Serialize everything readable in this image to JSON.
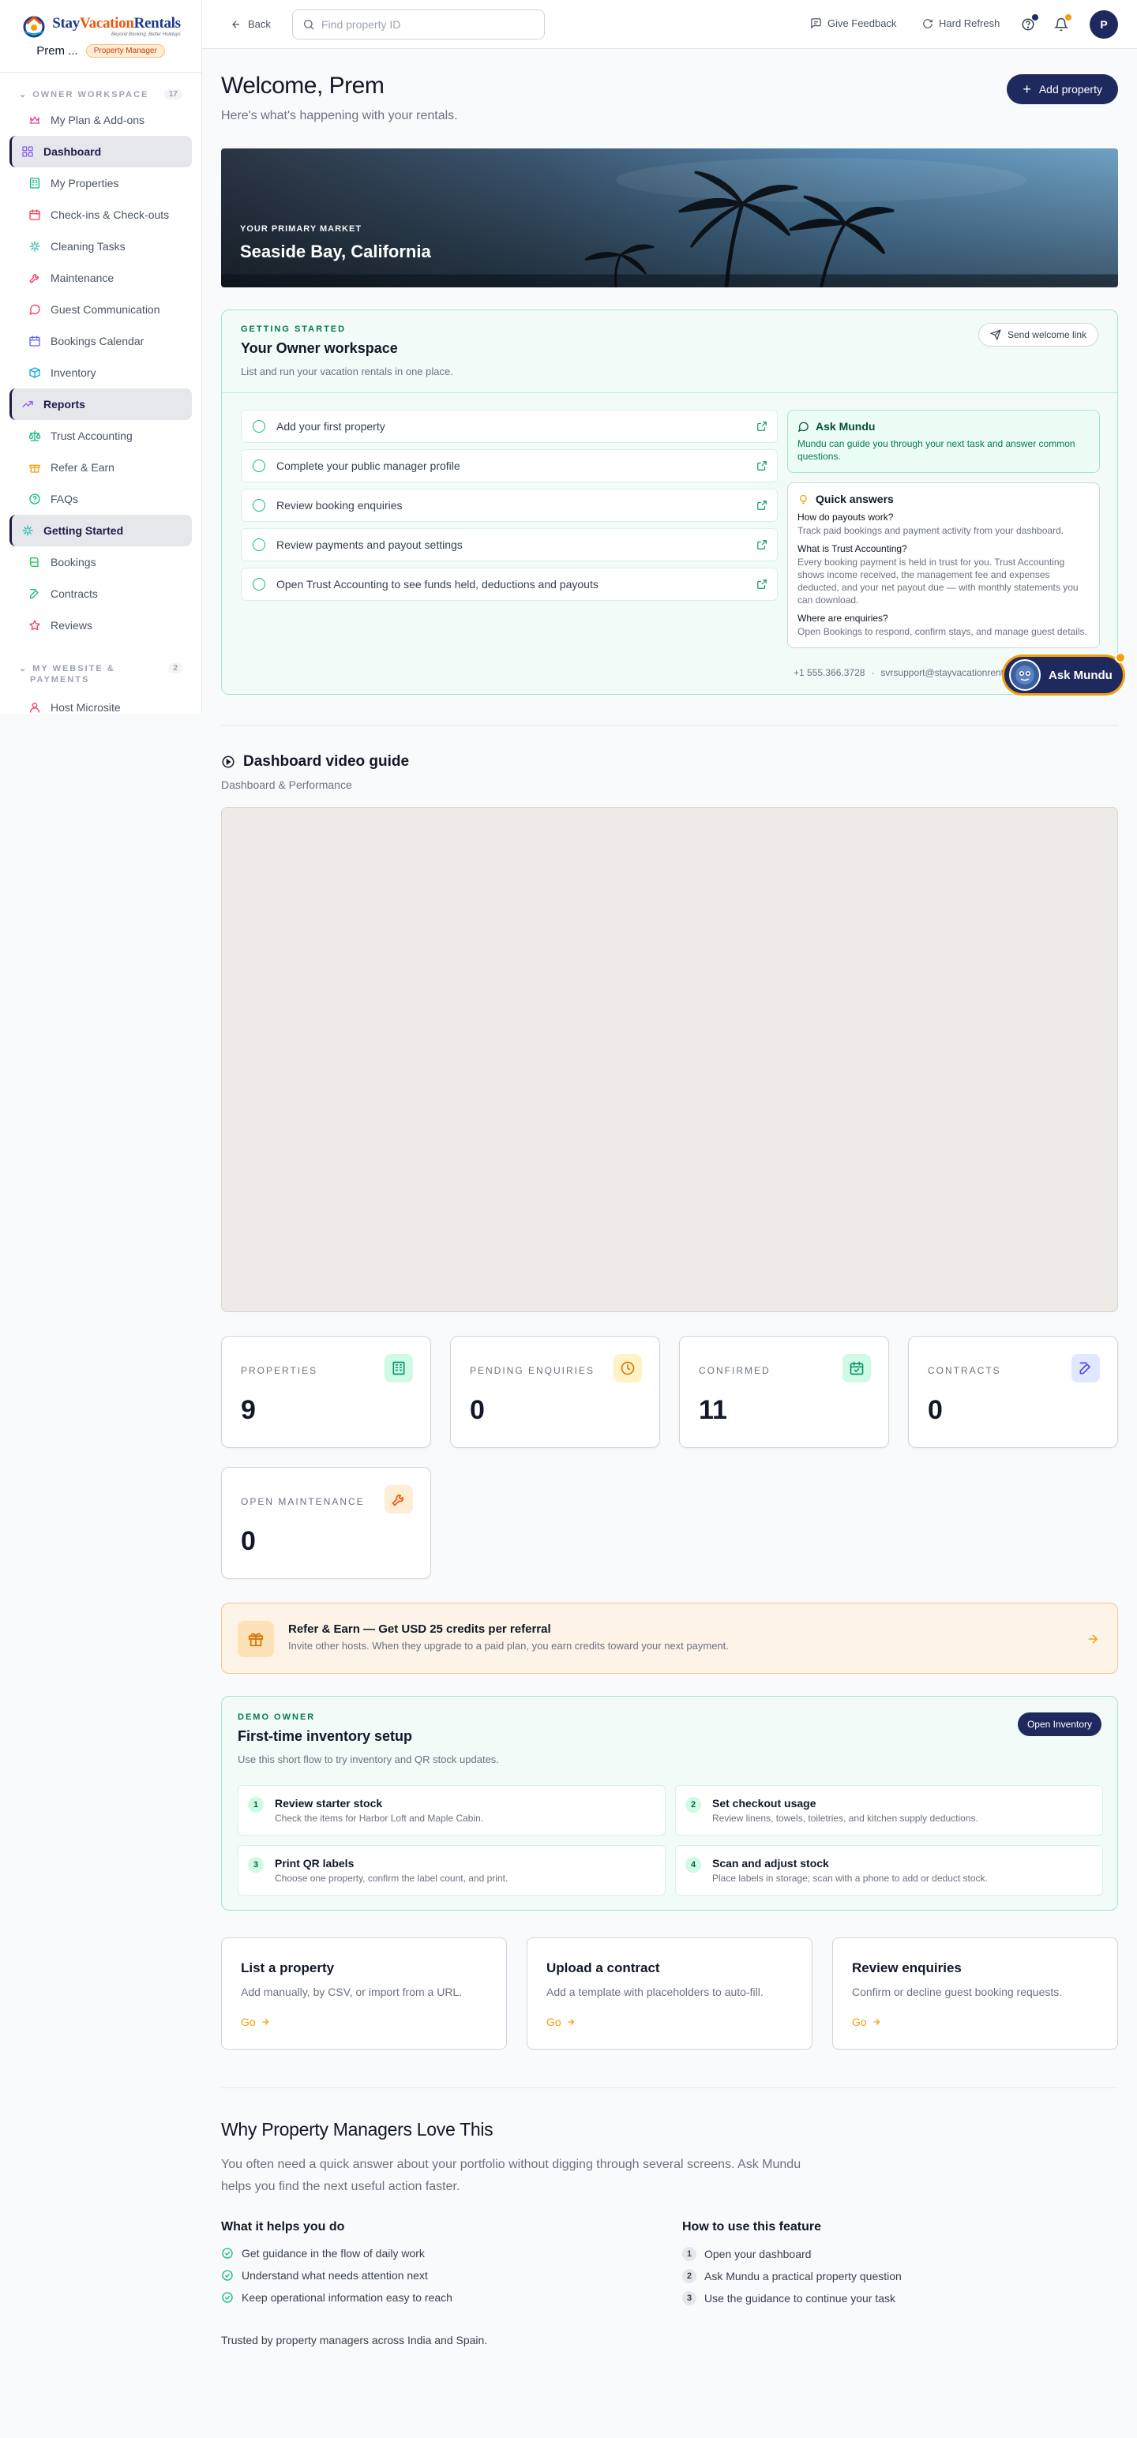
{
  "brand": {
    "logo_text_1": "Stay",
    "logo_text_2": "Vacation",
    "logo_text_3": "Rentals",
    "tagline": "Beyond Booking. Better Holidays",
    "user_name": "Prem ...",
    "role": "Property Manager"
  },
  "sidebar": {
    "section1": {
      "title": "OWNER WORKSPACE",
      "count": "17"
    },
    "items": [
      {
        "label": "My Plan & Add-ons",
        "icon": "crown-icon",
        "color": "#ec4899"
      },
      {
        "label": "Dashboard",
        "icon": "dashboard-icon",
        "color": "#8b5cf6",
        "active": true
      },
      {
        "label": "My Properties",
        "icon": "building-icon",
        "color": "#10b981"
      },
      {
        "label": "Check-ins & Check-outs",
        "icon": "calendar-icon",
        "color": "#f43f5e"
      },
      {
        "label": "Cleaning Tasks",
        "icon": "sparkle-icon",
        "color": "#14b8a6"
      },
      {
        "label": "Maintenance",
        "icon": "wrench-icon",
        "color": "#f43f5e"
      },
      {
        "label": "Guest Communication",
        "icon": "chat-icon",
        "color": "#f43f5e"
      },
      {
        "label": "Bookings Calendar",
        "icon": "calendar-icon",
        "color": "#6366f1"
      },
      {
        "label": "Inventory",
        "icon": "box-icon",
        "color": "#0ea5e9"
      },
      {
        "label": "Reports",
        "icon": "trend-icon",
        "color": "#8b5cf6",
        "active": true
      },
      {
        "label": "Trust Accounting",
        "icon": "scale-icon",
        "color": "#10b981"
      },
      {
        "label": "Refer & Earn",
        "icon": "gift-icon",
        "color": "#f59e0b"
      },
      {
        "label": "FAQs",
        "icon": "help-icon",
        "color": "#10b981"
      },
      {
        "label": "Getting Started",
        "icon": "sparkle-icon",
        "color": "#14b8a6",
        "active": true
      },
      {
        "label": "Bookings",
        "icon": "book-icon",
        "color": "#22c55e"
      },
      {
        "label": "Contracts",
        "icon": "edit-icon",
        "color": "#10b981"
      },
      {
        "label": "Reviews",
        "icon": "star-icon",
        "color": "#f43f5e"
      }
    ],
    "section2": {
      "title_line1": "MY WEBSITE &",
      "title_line2": "PAYMENTS",
      "count": "2"
    },
    "items2": [
      {
        "label": "Host Microsite",
        "icon": "user-icon",
        "color": "#f43f5e"
      }
    ]
  },
  "topbar": {
    "back": "Back",
    "search_placeholder": "Find property ID",
    "feedback": "Give Feedback",
    "refresh": "Hard Refresh",
    "avatar": "P",
    "colors": {
      "help_dot": "#1e2a5e",
      "bell_dot": "#f59e0b"
    }
  },
  "header": {
    "title": "Welcome, Prem",
    "subtitle": "Here's what's happening with your rentals.",
    "add_button": "Add property"
  },
  "hero": {
    "kicker": "YOUR PRIMARY MARKET",
    "city": "Seaside Bay, California"
  },
  "getting_started": {
    "label": "GETTING STARTED",
    "title": "Your Owner workspace",
    "desc": "List and run your vacation rentals in one place.",
    "send_btn": "Send welcome link",
    "tasks": [
      "Add your first property",
      "Complete your public manager profile",
      "Review booking enquiries",
      "Review payments and payout settings",
      "Open Trust Accounting to see funds held, deductions and payouts"
    ],
    "ask": {
      "title": "Ask Mundu",
      "desc": "Mundu can guide you through your next task and answer common questions."
    },
    "quick": {
      "title": "Quick answers",
      "items": [
        {
          "q": "How do payouts work?",
          "a": "Track paid bookings and payment activity from your dashboard."
        },
        {
          "q": "What is Trust Accounting?",
          "a": "Every booking payment is held in trust for you. Trust Accounting shows income received, the management fee and expenses deducted, and your net payout due — with monthly statements you can download."
        },
        {
          "q": "Where are enquiries?",
          "a": "Open Bookings to respond, confirm stays, and manage guest details."
        }
      ]
    },
    "phone": "+1 555.366.3728",
    "sep": "·",
    "email": "svrsupport@stayvacationrentals.com",
    "fab": "Ask Mundu"
  },
  "video": {
    "title": "Dashboard video guide",
    "sub": "Dashboard & Performance"
  },
  "stats": [
    {
      "label": "PROPERTIES",
      "value": "9",
      "icon": "building-icon",
      "bg": "#d1fae5",
      "fg": "#059669"
    },
    {
      "label": "PENDING ENQUIRIES",
      "value": "0",
      "icon": "clock-icon",
      "bg": "#fef3c7",
      "fg": "#d97706"
    },
    {
      "label": "CONFIRMED",
      "value": "11",
      "icon": "calendar-check-icon",
      "bg": "#d1fae5",
      "fg": "#059669"
    },
    {
      "label": "CONTRACTS",
      "value": "0",
      "icon": "edit-icon",
      "bg": "#e0e7ff",
      "fg": "#4f46e5"
    },
    {
      "label": "OPEN MAINTENANCE",
      "value": "0",
      "icon": "wrench-icon",
      "bg": "#ffedd5",
      "fg": "#ea580c"
    }
  ],
  "refer": {
    "title": "Refer & Earn — Get USD 25 credits per referral",
    "desc": "Invite other hosts. When they upgrade to a paid plan, you earn credits toward your next payment."
  },
  "demo": {
    "label": "DEMO OWNER",
    "title": "First-time inventory setup",
    "desc": "Use this short flow to try inventory and QR stock updates.",
    "button": "Open Inventory",
    "steps": [
      {
        "n": "1",
        "t": "Review starter stock",
        "d": "Check the items for Harbor Loft and Maple Cabin."
      },
      {
        "n": "2",
        "t": "Set checkout usage",
        "d": "Review linens, towels, toiletries, and kitchen supply deductions."
      },
      {
        "n": "3",
        "t": "Print QR labels",
        "d": "Choose one property, confirm the label count, and print."
      },
      {
        "n": "4",
        "t": "Scan and adjust stock",
        "d": "Place labels in storage; scan with a phone to add or deduct stock."
      }
    ]
  },
  "actions": [
    {
      "t": "List a property",
      "d": "Add manually, by CSV, or import from a URL.",
      "go": "Go"
    },
    {
      "t": "Upload a contract",
      "d": "Add a template with placeholders to auto-fill.",
      "go": "Go"
    },
    {
      "t": "Review enquiries",
      "d": "Confirm or decline guest booking requests.",
      "go": "Go"
    }
  ],
  "why": {
    "title": "Why Property Managers Love This",
    "desc": "You often need a quick answer about your portfolio without digging through several screens. Ask Mundu helps you find the next useful action faster.",
    "helps_title": "What it helps you do",
    "helps": [
      "Get guidance in the flow of daily work",
      "Understand what needs attention next",
      "Keep operational information easy to reach"
    ],
    "how_title": "How to use this feature",
    "how": [
      {
        "n": "1",
        "t": "Open your dashboard"
      },
      {
        "n": "2",
        "t": "Ask Mundu a practical property question"
      },
      {
        "n": "3",
        "t": "Use the guidance to continue your task"
      }
    ],
    "trusted": "Trusted by property managers across India and Spain."
  }
}
